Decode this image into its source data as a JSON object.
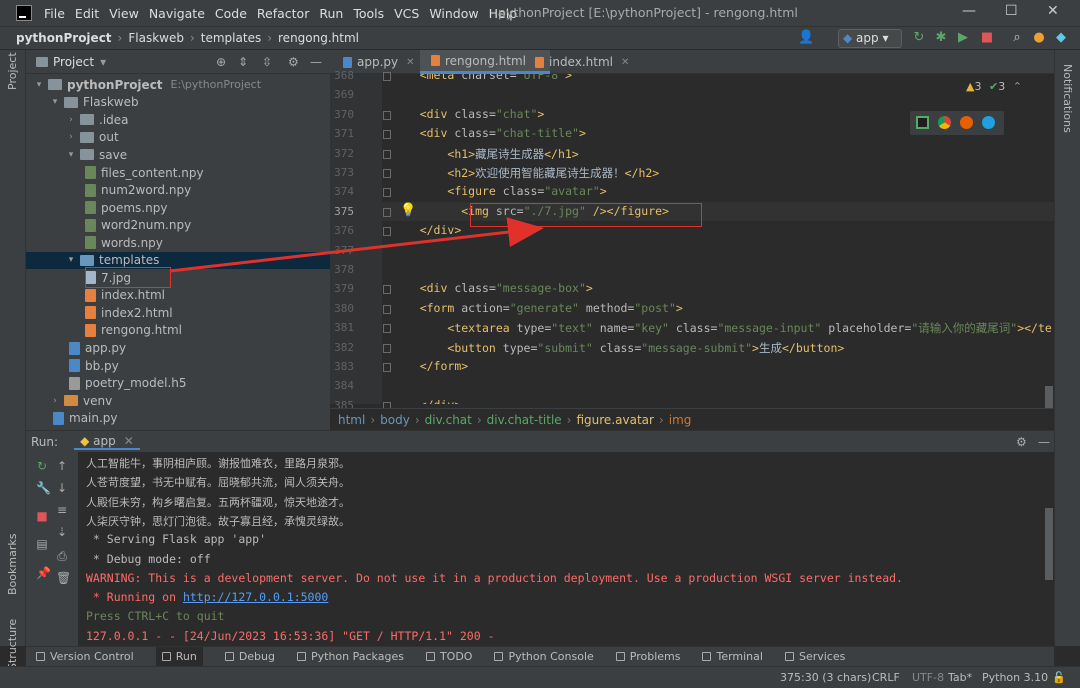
{
  "window": {
    "menu": [
      "File",
      "Edit",
      "View",
      "Navigate",
      "Code",
      "Refactor",
      "Run",
      "Tools",
      "VCS",
      "Window",
      "Help"
    ],
    "title": "pythonProject [E:\\pythonProject] - rengong.html",
    "min": "—",
    "max": "☐",
    "close": "✕"
  },
  "nav": {
    "crumbs": [
      "pythonProject",
      "Flaskweb",
      "templates",
      "rengong.html"
    ],
    "run_config": "app"
  },
  "project": {
    "title": "Project",
    "root_name": "pythonProject",
    "root_path": "E:\\pythonProject",
    "tree": [
      {
        "label": "pythonProject",
        "depth": 0,
        "kind": "folder",
        "open": true
      },
      {
        "label": "Flaskweb",
        "depth": 1,
        "kind": "folder",
        "open": true
      },
      {
        "label": ".idea",
        "depth": 2,
        "kind": "folder",
        "open": false
      },
      {
        "label": "out",
        "depth": 2,
        "kind": "folder",
        "open": false
      },
      {
        "label": "save",
        "depth": 2,
        "kind": "folder",
        "open": true
      },
      {
        "label": "files_content.npy",
        "depth": 3,
        "kind": "npy"
      },
      {
        "label": "num2word.npy",
        "depth": 3,
        "kind": "npy"
      },
      {
        "label": "poems.npy",
        "depth": 3,
        "kind": "npy"
      },
      {
        "label": "word2num.npy",
        "depth": 3,
        "kind": "npy"
      },
      {
        "label": "words.npy",
        "depth": 3,
        "kind": "npy"
      },
      {
        "label": "templates",
        "depth": 2,
        "kind": "folder",
        "open": true,
        "selected": true
      },
      {
        "label": "7.jpg",
        "depth": 3,
        "kind": "jpg"
      },
      {
        "label": "index.html",
        "depth": 3,
        "kind": "html"
      },
      {
        "label": "index2.html",
        "depth": 3,
        "kind": "html"
      },
      {
        "label": "rengong.html",
        "depth": 3,
        "kind": "html"
      },
      {
        "label": "app.py",
        "depth": 2,
        "kind": "py"
      },
      {
        "label": "bb.py",
        "depth": 2,
        "kind": "py"
      },
      {
        "label": "poetry_model.h5",
        "depth": 2,
        "kind": "h5"
      },
      {
        "label": "venv",
        "depth": 1,
        "kind": "folder-orange",
        "open": false
      },
      {
        "label": "main.py",
        "depth": 1,
        "kind": "py"
      }
    ]
  },
  "tabs": [
    {
      "label": "app.py",
      "active": false
    },
    {
      "label": "rengong.html",
      "active": true
    },
    {
      "label": "index.html",
      "active": false
    }
  ],
  "inspection": {
    "warnings": "3",
    "checks": "3"
  },
  "code": [
    {
      "n": "368",
      "segs": [
        [
          "    ",
          ""
        ],
        [
          "<meta ",
          "tg"
        ],
        [
          "charset=",
          "at"
        ],
        [
          "\"UTF-8\"",
          "st"
        ],
        [
          ">",
          "tg"
        ]
      ]
    },
    {
      "n": "369",
      "segs": []
    },
    {
      "n": "370",
      "segs": [
        [
          "    ",
          ""
        ],
        [
          "<div ",
          "tg"
        ],
        [
          "class=",
          "at"
        ],
        [
          "\"chat\"",
          "st"
        ],
        [
          ">",
          "tg"
        ]
      ]
    },
    {
      "n": "371",
      "segs": [
        [
          "    ",
          ""
        ],
        [
          "<div ",
          "tg"
        ],
        [
          "class=",
          "at"
        ],
        [
          "\"chat-title\"",
          "st"
        ],
        [
          ">",
          "tg"
        ]
      ]
    },
    {
      "n": "372",
      "segs": [
        [
          "        ",
          ""
        ],
        [
          "<h1>",
          "tg"
        ],
        [
          "藏尾诗生成器",
          ""
        ],
        [
          "</h1>",
          "tg"
        ]
      ]
    },
    {
      "n": "373",
      "segs": [
        [
          "        ",
          ""
        ],
        [
          "<h2>",
          "tg"
        ],
        [
          "欢迎使用智能藏尾诗生成器！",
          ""
        ],
        [
          "</h2>",
          "tg"
        ]
      ]
    },
    {
      "n": "374",
      "segs": [
        [
          "        ",
          ""
        ],
        [
          "<figure ",
          "tg"
        ],
        [
          "class=",
          "at"
        ],
        [
          "\"avatar\"",
          "st"
        ],
        [
          ">",
          "tg"
        ]
      ]
    },
    {
      "n": "375",
      "segs": [
        [
          "          ",
          ""
        ],
        [
          "<img ",
          "tg"
        ],
        [
          "src=",
          "at"
        ],
        [
          "\"./7.jpg\"",
          "st"
        ],
        [
          " />",
          "tg"
        ],
        [
          "</figure>",
          "tg"
        ]
      ]
    },
    {
      "n": "376",
      "segs": [
        [
          "    ",
          ""
        ],
        [
          "</div>",
          "tg"
        ]
      ]
    },
    {
      "n": "377",
      "segs": []
    },
    {
      "n": "378",
      "segs": []
    },
    {
      "n": "379",
      "segs": [
        [
          "    ",
          ""
        ],
        [
          "<div ",
          "tg"
        ],
        [
          "class=",
          "at"
        ],
        [
          "\"message-box\"",
          "st"
        ],
        [
          ">",
          "tg"
        ]
      ]
    },
    {
      "n": "380",
      "segs": [
        [
          "    ",
          ""
        ],
        [
          "<form ",
          "tg"
        ],
        [
          "action=",
          "at"
        ],
        [
          "\"generate\" ",
          "st"
        ],
        [
          "method=",
          "at"
        ],
        [
          "\"post\"",
          "st"
        ],
        [
          ">",
          "tg"
        ]
      ]
    },
    {
      "n": "381",
      "segs": [
        [
          "        ",
          ""
        ],
        [
          "<textarea ",
          "tg"
        ],
        [
          "type=",
          "at"
        ],
        [
          "\"text\" ",
          "st"
        ],
        [
          "name=",
          "at"
        ],
        [
          "\"key\" ",
          "st"
        ],
        [
          "class=",
          "at"
        ],
        [
          "\"message-input\" ",
          "st"
        ],
        [
          "placeholder=",
          "at"
        ],
        [
          "\"请输入你的藏尾词\"",
          "st"
        ],
        [
          "></te",
          "tg"
        ]
      ]
    },
    {
      "n": "382",
      "segs": [
        [
          "        ",
          ""
        ],
        [
          "<button ",
          "tg"
        ],
        [
          "type=",
          "at"
        ],
        [
          "\"submit\" ",
          "st"
        ],
        [
          "class=",
          "at"
        ],
        [
          "\"message-submit\"",
          "st"
        ],
        [
          ">",
          "tg"
        ],
        [
          "生成",
          ""
        ],
        [
          "</button>",
          "tg"
        ]
      ]
    },
    {
      "n": "383",
      "segs": [
        [
          "    ",
          ""
        ],
        [
          "</form>",
          "tg"
        ]
      ]
    },
    {
      "n": "384",
      "segs": []
    },
    {
      "n": "385",
      "segs": [
        [
          "    ",
          ""
        ],
        [
          "</div>",
          "tg"
        ]
      ]
    }
  ],
  "breadcrumb": [
    "html",
    "body",
    "div.chat",
    "div.chat-title",
    "figure.avatar",
    "img"
  ],
  "run": {
    "label": "Run:",
    "config": "app",
    "lines": [
      {
        "t": "人工智能牛，事阴相庐顾。谢报恤难衣，里路月泉邪。",
        "c": "cn"
      },
      {
        "t": "人苍苛度望，书无中赋有。屈晓郁共流，闻人须关舟。",
        "c": "cn"
      },
      {
        "t": "人殿佢未穷，构乡曙启复。五两杯疆观，惊天地途才。",
        "c": "cn"
      },
      {
        "t": "人柒厌守钟，思灯门泡徒。故子寡且经，承愧灵绿故。",
        "c": "cn"
      },
      {
        "t": " * Serving Flask app 'app'",
        "c": ""
      },
      {
        "t": " * Debug mode: off",
        "c": ""
      },
      {
        "t": "WARNING: This is a development server. Do not use it in a production deployment. Use a production WSGI server instead.",
        "c": "red"
      },
      {
        "t": " * Running on ",
        "c": "red",
        "link": "http://127.0.0.1:5000"
      },
      {
        "t": "Press CTRL+C to quit",
        "c": "green"
      },
      {
        "t": "127.0.0.1 - - [24/Jun/2023 16:53:36] \"GET / HTTP/1.1\" 200 -",
        "c": "red"
      }
    ]
  },
  "bottom_tools": [
    "Version Control",
    "Run",
    "Debug",
    "Python Packages",
    "TODO",
    "Python Console",
    "Problems",
    "Terminal",
    "Services"
  ],
  "status": {
    "position": "375:30 (3 chars)",
    "line_sep": "CRLF",
    "encoding": "UTF-8",
    "indent": "Tab*",
    "interpreter": "Python 3.10"
  },
  "side": {
    "project": "Project",
    "bookmarks": "Bookmarks",
    "structure": "Structure",
    "notifications": "Notifications"
  },
  "colors": {
    "accent": "#4a88c7",
    "annotation": "#e0312b",
    "tag": "#e8bf6a",
    "string": "#6a8759"
  }
}
